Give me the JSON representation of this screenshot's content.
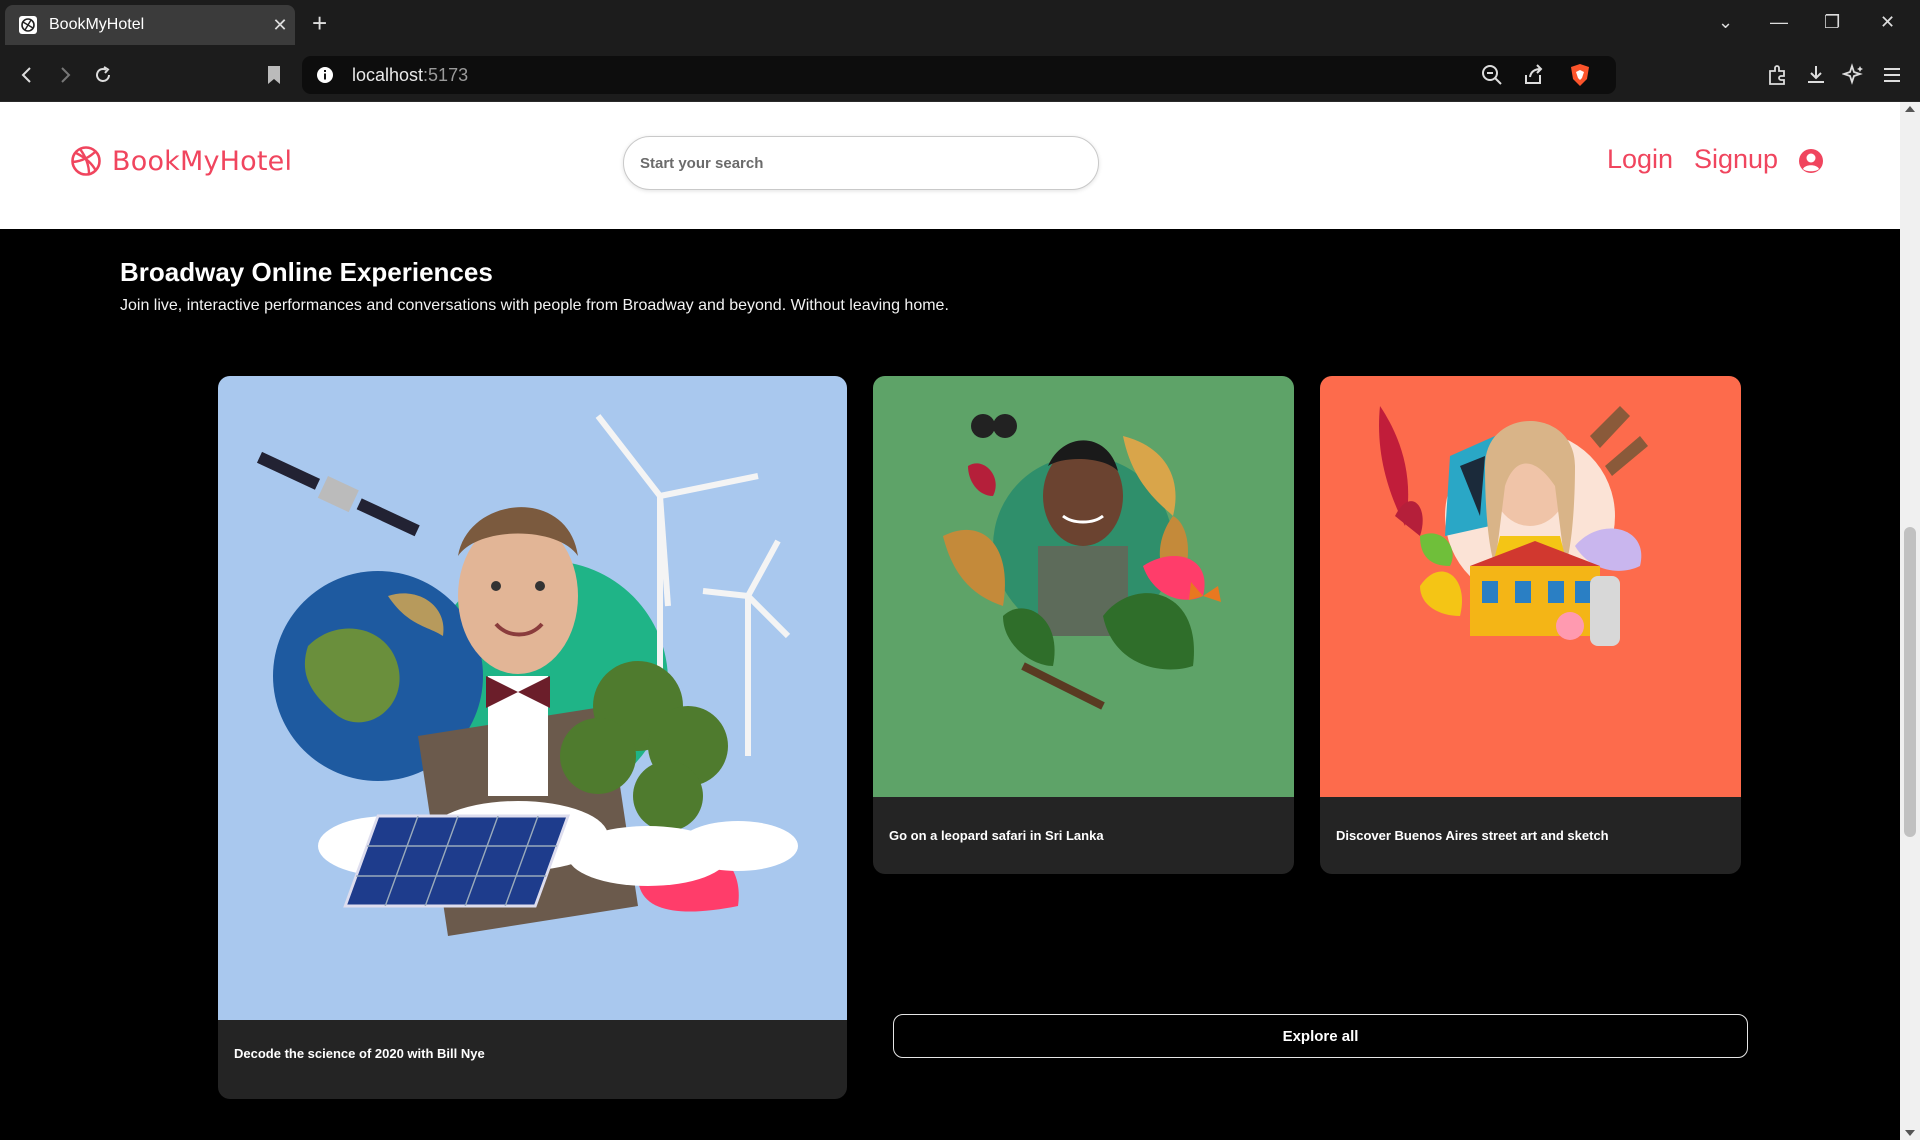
{
  "browser": {
    "tab_title": "BookMyHotel",
    "url_host": "localhost",
    "url_port": ":5173"
  },
  "header": {
    "brand": "BookMyHotel",
    "search_placeholder": "Start your search",
    "login": "Login",
    "signup": "Signup"
  },
  "section": {
    "title": "Broadway Online Experiences",
    "subtitle": "Join live, interactive performances and conversations with people from Broadway and beyond. Without leaving home."
  },
  "cards": [
    {
      "caption": "Decode the science of 2020 with Bill Nye",
      "image_bg": "#a9c8ee"
    },
    {
      "caption": "Go on a leopard safari in Sri Lanka",
      "image_bg": "#5ea368"
    },
    {
      "caption": "Discover Buenos Aires street art and sketch",
      "image_bg": "#fd6b4c"
    }
  ],
  "explore_label": "Explore all",
  "colors": {
    "brand": "#f0455e",
    "card_bg": "#242424"
  }
}
